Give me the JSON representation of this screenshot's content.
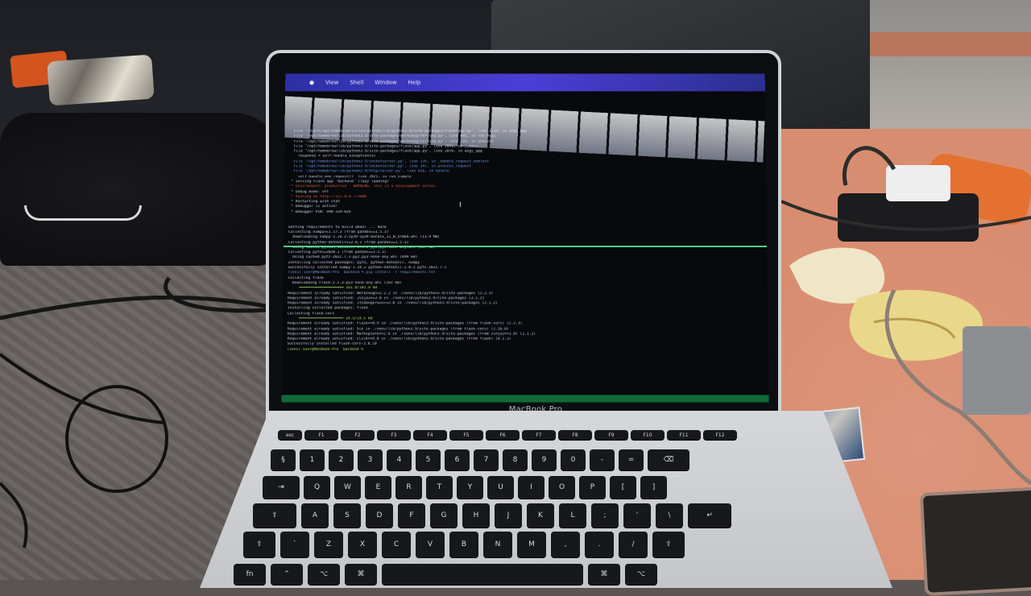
{
  "scene": {
    "description_colors": {
      "table": "#d98d70",
      "carpet": "#605a58",
      "menubar": "#3a3fc0",
      "terminal_bg": "#07090c",
      "divider": "#4fd08a"
    }
  },
  "laptop": {
    "brand": "MacBook Pro",
    "menubar_items": [
      "View",
      "Shell",
      "Window",
      "Help"
    ],
    "terminal_lines": [
      {
        "t": "  File \"/Users/opt/homebrew/Cellar/python/lib/python3.9/site-packages/flask/app.py\", line 1234, in wsgi_app",
        "c": ""
      },
      {
        "t": "  File \"/opt/homebrew/lib/python3.9/site-packages/werkzeug/serving.py\", line 885, in run_wsgi",
        "c": ""
      },
      {
        "t": "  File \"/opt/homebrew/lib/python3.9/site-packages/werkzeug/serving.py\", line 216, in execute",
        "c": ""
      },
      {
        "t": "  File \"/opt/homebrew/lib/python3.9/site-packages/flask/app.py\", line 2091, in __call__",
        "c": ""
      },
      {
        "t": "  File \"/opt/homebrew/lib/python3.9/site-packages/flask/app.py\", line 2076, in wsgi_app",
        "c": ""
      },
      {
        "t": "    response = self.handle_exception(e)",
        "c": ""
      },
      {
        "t": "  File \"/opt/homebrew/lib/python3.9/socketserver.py\", line 316, in _handle_request_noblock",
        "c": "blue"
      },
      {
        "t": "  File \"/opt/homebrew/lib/python3.9/socketserver.py\", line 347, in process_request",
        "c": "blue"
      },
      {
        "t": "  File \"/opt/homebrew/lib/python3.9/http/server.py\", line 426, in handle",
        "c": "blue"
      },
      {
        "t": "    self.handle_one_request()  line 2021, in run_simple",
        "c": ""
      },
      {
        "t": " * Serving Flask app 'backend' (lazy loading)",
        "c": ""
      },
      {
        "t": " * Environment: production   WARNING: This is a development server.",
        "c": "err"
      },
      {
        "t": " * Debug mode: off",
        "c": ""
      },
      {
        "t": " * Running on http://127.0.0.1:5000",
        "c": "err"
      },
      {
        "t": " * Restarting with stat",
        "c": ""
      },
      {
        "t": " * Debugger is active!",
        "c": ""
      },
      {
        "t": " * Debugger PIN: 498-334-026",
        "c": ""
      },
      {
        "t": "",
        "c": ""
      },
      {
        "t": "",
        "c": ""
      },
      {
        "t": "Getting requirements to build wheel ... done",
        "c": ""
      },
      {
        "t": "Collecting numpy>=1.17.3 (from pandas==1.5.3)",
        "c": ""
      },
      {
        "t": "  Downloading numpy-1.24.2-cp39-cp39-macosx_11_0_arm64.whl (13.9 MB)",
        "c": ""
      },
      {
        "t": "Collecting python-dateutil>=2.8.1 (from pandas==1.5.3)",
        "c": ""
      },
      {
        "t": "  Using cached python_dateutil-2.8.2-py2.py3-none-any.whl (247 kB)",
        "c": ""
      },
      {
        "t": "Collecting pytz>=2020.1 (from pandas==1.5.3)",
        "c": ""
      },
      {
        "t": "  Using cached pytz-2022.7.1-py2.py3-none-any.whl (499 kB)",
        "c": ""
      },
      {
        "t": "Installing collected packages: pytz, python-dateutil, numpy",
        "c": ""
      },
      {
        "t": "Successfully installed numpy-1.24.2 python-dateutil-2.8.2 pytz-2022.7.1",
        "c": ""
      },
      {
        "t": "(venv) user@MacBook-Pro  backend % pip install -r requirements.txt",
        "c": "blue"
      },
      {
        "t": "Collecting flask",
        "c": ""
      },
      {
        "t": "  Downloading Flask-2.2.3-py3-none-any.whl (101 kB)",
        "c": ""
      },
      {
        "t": "     ━━━━━━━━━━━━━━━━━━━━ 101.8/101.8 kB",
        "c": "ok"
      },
      {
        "t": "Requirement already satisfied: Werkzeug>=2.2.2 in ./venv/lib/python3.9/site-packages (2.2.3)",
        "c": ""
      },
      {
        "t": "Requirement already satisfied: Jinja2>=3.0 in ./venv/lib/python3.9/site-packages (3.1.2)",
        "c": ""
      },
      {
        "t": "Requirement already satisfied: itsdangerous>=2.0 in ./venv/lib/python3.9/site-packages (2.1.2)",
        "c": ""
      },
      {
        "t": "Installing collected packages: flask",
        "c": ""
      },
      {
        "t": "Collecting flask-cors",
        "c": ""
      },
      {
        "t": "     ━━━━━━━━━━━━━━━━━━━━ 14.5/14.5 kB",
        "c": "ok"
      },
      {
        "t": "Requirement already satisfied: Flask>=0.9 in ./venv/lib/python3.9/site-packages (from flask-cors) (2.2.3)",
        "c": ""
      },
      {
        "t": "Requirement already satisfied: Six in ./venv/lib/python3.9/site-packages (from flask-cors) (1.16.0)",
        "c": ""
      },
      {
        "t": "Requirement already satisfied: MarkupSafe>=2.0 in ./venv/lib/python3.9/site-packages (from Jinja2>=3.0) (2.1.2)",
        "c": ""
      },
      {
        "t": "Requirement already satisfied: click>=8.0 in ./venv/lib/python3.9/site-packages (from flask) (8.1.3)",
        "c": ""
      },
      {
        "t": "Successfully installed flask-cors-3.0.10",
        "c": ""
      },
      {
        "t": "(venv) user@MacBook-Pro  backend %",
        "c": "ok"
      }
    ],
    "keyboard_rows": [
      [
        "esc",
        "F1",
        "F2",
        "F3",
        "F4",
        "F5",
        "F6",
        "F7",
        "F8",
        "F9",
        "F10",
        "F11",
        "F12"
      ],
      [
        "§",
        "1",
        "2",
        "3",
        "4",
        "5",
        "6",
        "7",
        "8",
        "9",
        "0",
        "-",
        "=",
        "⌫"
      ],
      [
        "⇥",
        "Q",
        "W",
        "E",
        "R",
        "T",
        "Y",
        "U",
        "I",
        "O",
        "P",
        "[",
        "]"
      ],
      [
        "⇪",
        "A",
        "S",
        "D",
        "F",
        "G",
        "H",
        "J",
        "K",
        "L",
        ";",
        "'",
        "\\",
        "↵"
      ],
      [
        "⇧",
        "`",
        "Z",
        "X",
        "C",
        "V",
        "B",
        "N",
        "M",
        ",",
        ".",
        "/",
        "⇧"
      ],
      [
        "fn",
        "⌃",
        "⌥",
        "⌘",
        "",
        "⌘",
        "⌥"
      ]
    ]
  }
}
